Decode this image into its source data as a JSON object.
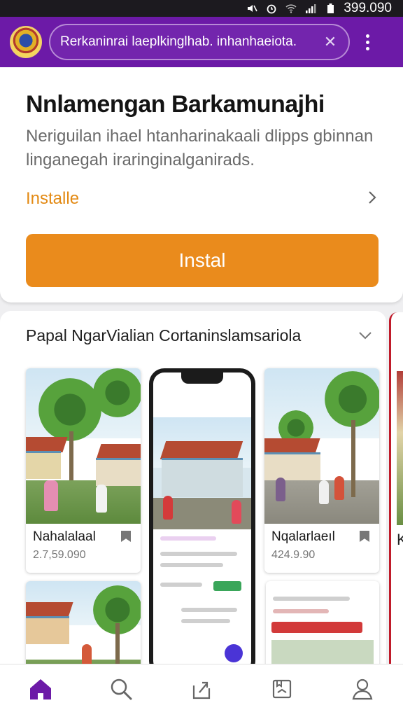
{
  "status_bar": {
    "time": "399.090",
    "icons": [
      "mute-icon",
      "alarm-icon",
      "wifi-icon",
      "signal-icon",
      "battery-icon"
    ]
  },
  "topbar": {
    "search_text": "Rerkaninrai laeplkinglhab. inhanhaeiota.",
    "bg_color": "#6c1aa7"
  },
  "app": {
    "title": "Nnlamengan Barkamunajhi",
    "description": "Neriguilan ihael htanharinakaali dlipps gbinnan linganegah iraringinalganirads.",
    "installs_label": "Installe",
    "install_button": "Instal",
    "accent_color": "#ea8b1c"
  },
  "gallery": {
    "header": "Papal NgarVialian Cortaninslamsariola",
    "tiles": [
      {
        "caption": "Nahalalaal",
        "count": "2.7,59.090"
      },
      {
        "caption": "Nqalarlaeıl",
        "count": "424.9.90"
      }
    ],
    "edge_caption": "K"
  },
  "bottom_nav": [
    "home-icon",
    "search-icon",
    "share-icon",
    "library-icon",
    "profile-icon"
  ]
}
